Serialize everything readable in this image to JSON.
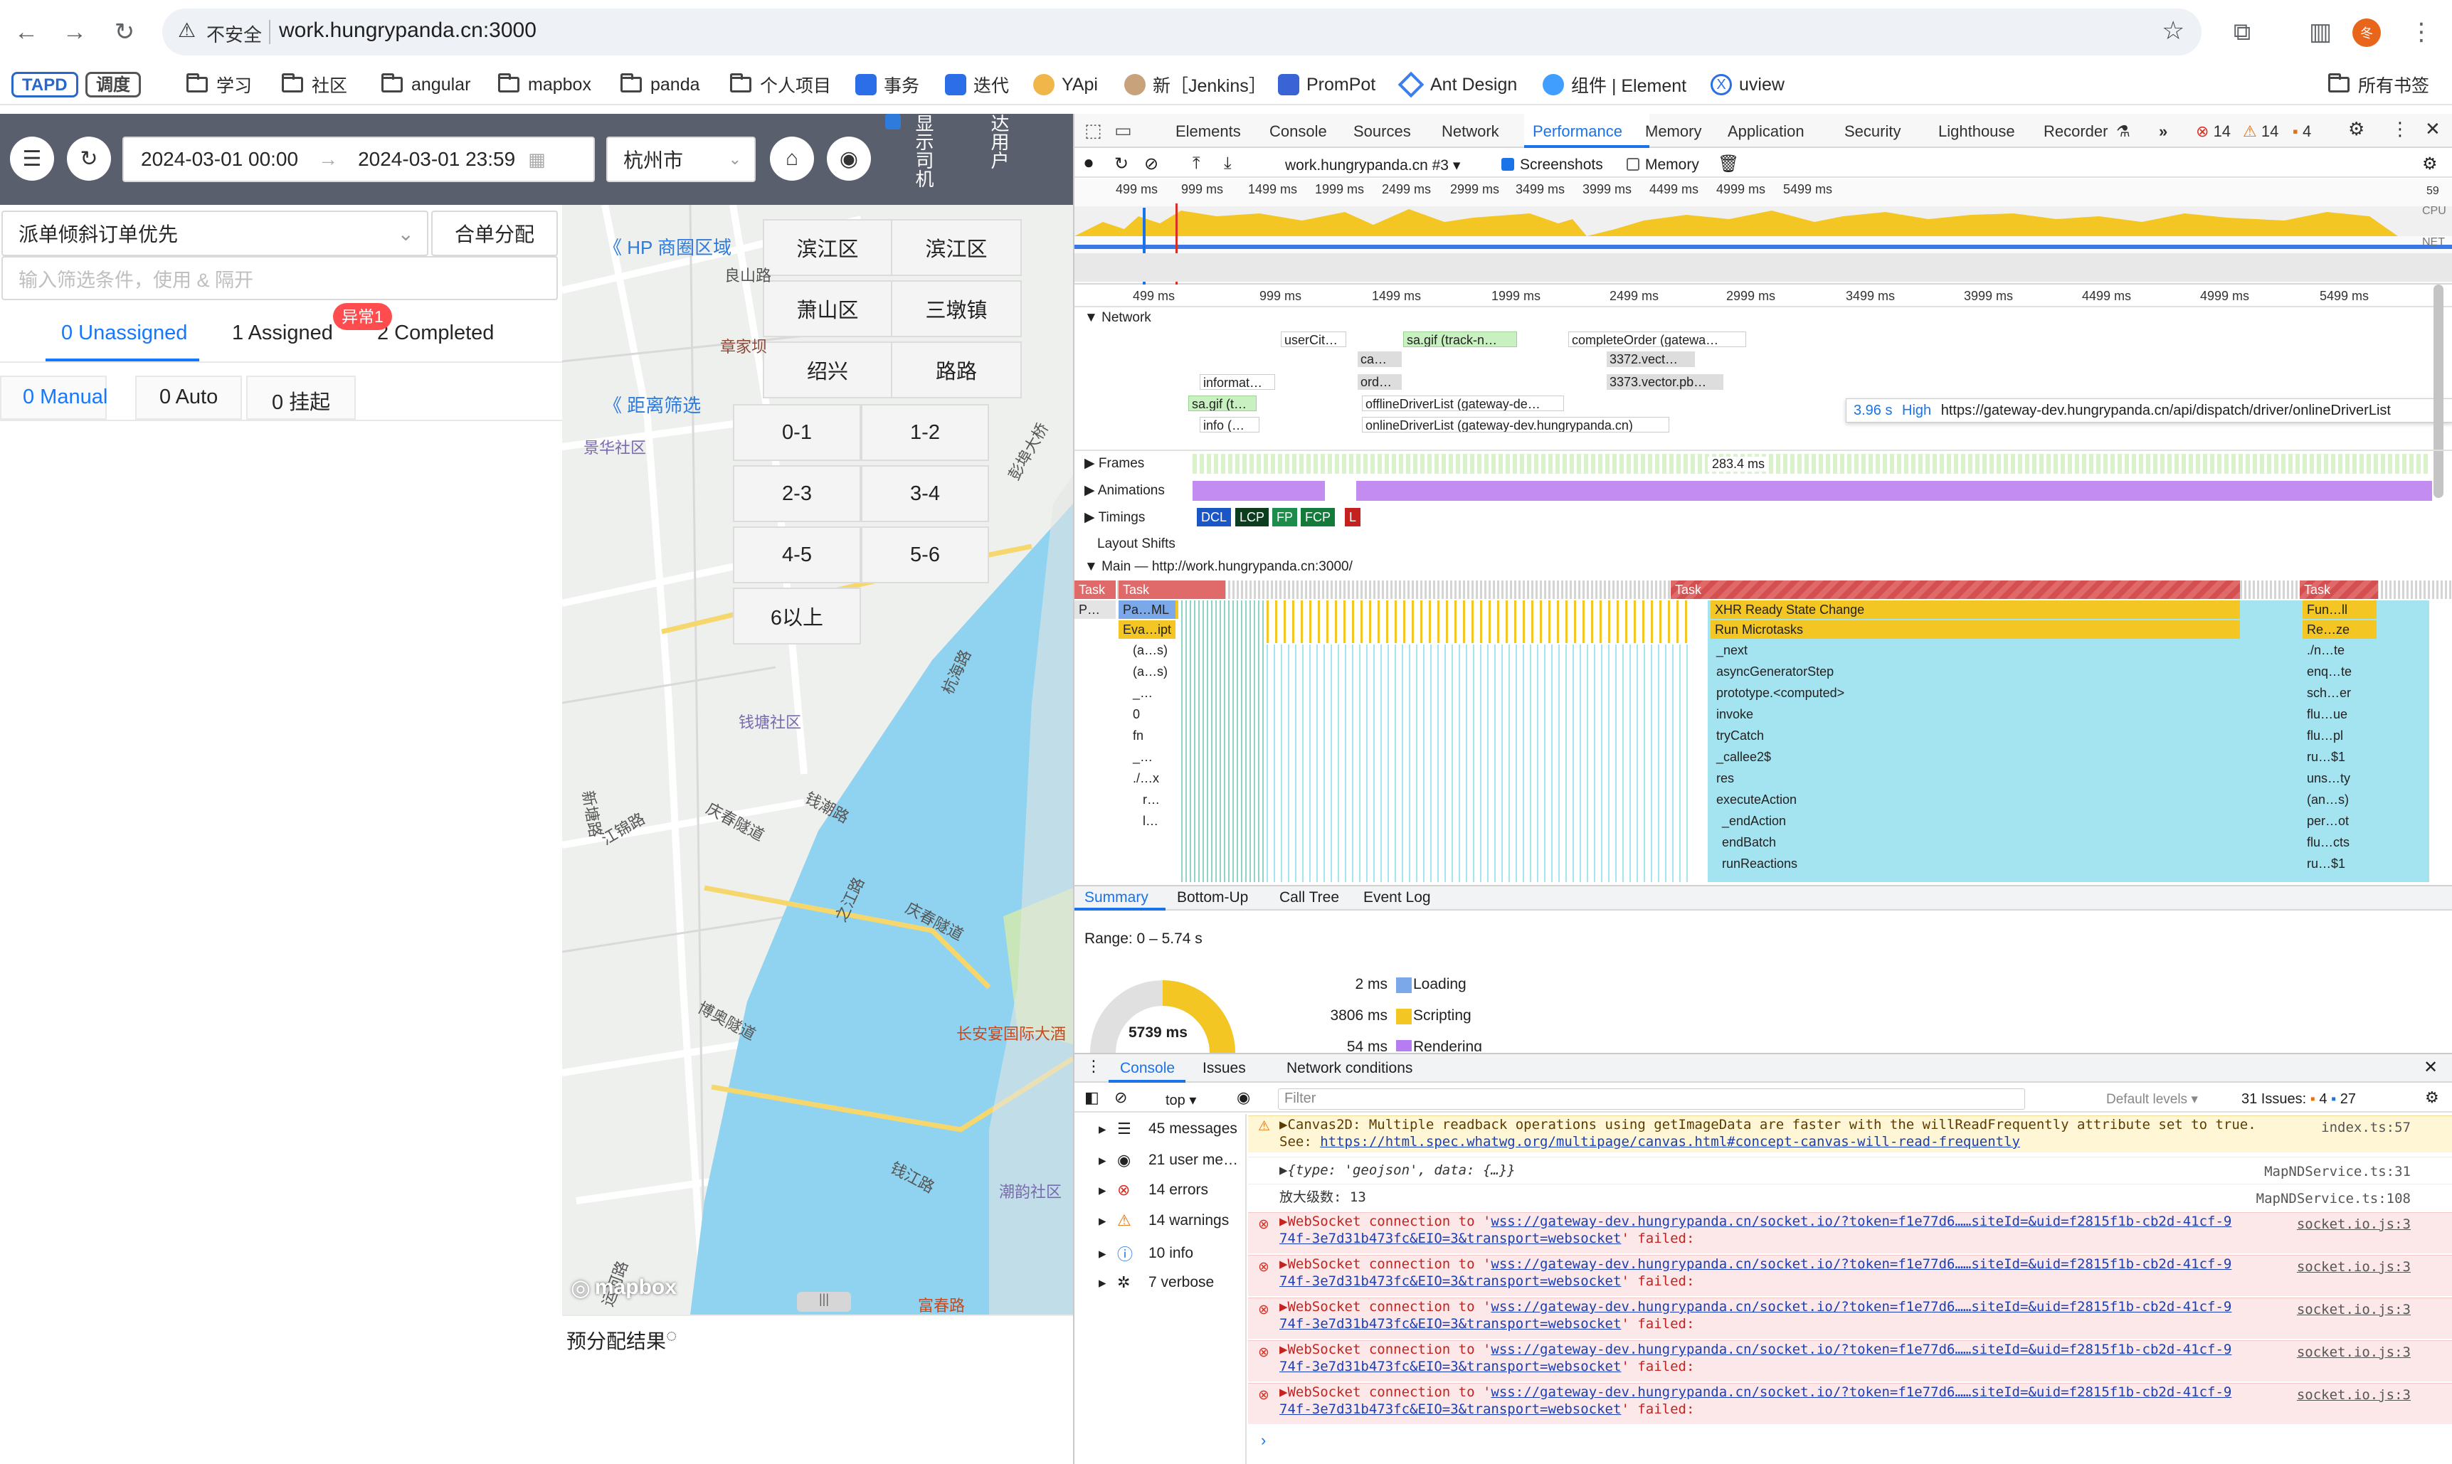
{
  "browser": {
    "security_label": "不安全",
    "url": "work.hungrypanda.cn:3000",
    "profile_initial": "冬",
    "bookmarks": [
      {
        "label": "TAPD",
        "kind": "tag"
      },
      {
        "label": "调度",
        "kind": "tag"
      },
      {
        "label": "学习",
        "kind": "folder"
      },
      {
        "label": "社区",
        "kind": "folder"
      },
      {
        "label": "angular",
        "kind": "folder"
      },
      {
        "label": "mapbox",
        "kind": "folder"
      },
      {
        "label": "panda",
        "kind": "folder"
      },
      {
        "label": "个人项目",
        "kind": "folder"
      },
      {
        "label": "事务",
        "kind": "site"
      },
      {
        "label": "迭代",
        "kind": "site"
      },
      {
        "label": "YApi",
        "kind": "site"
      },
      {
        "label": "新［Jenkins］",
        "kind": "site"
      },
      {
        "label": "PromPot",
        "kind": "site"
      },
      {
        "label": "Ant Design",
        "kind": "site"
      },
      {
        "label": "组件 | Element",
        "kind": "site"
      },
      {
        "label": "uview",
        "kind": "site"
      }
    ],
    "all_bookmarks": "所有书签"
  },
  "app": {
    "date_start": "2024-03-01 00:00",
    "date_sep": "→",
    "date_end": "2024-03-01 23:59",
    "city": "杭州市",
    "toggle_label_1": "显示司机",
    "toggle_label_2": "达用户",
    "strategy_select": "派单倾斜订单优先",
    "merge_button": "合单分配",
    "filter_placeholder": "输入筛选条件，使用 & 隔开",
    "status_tabs": [
      "0 Unassigned",
      "1 Assigned",
      "2 Completed"
    ],
    "exception_badge": "异常1",
    "sub_tabs": [
      "0 Manual",
      "0 Auto",
      "0 挂起"
    ]
  },
  "map": {
    "hp_area_link": "HP 商圈区域",
    "distance_filter_link": "距离筛选",
    "area_buttons": [
      "滨江区",
      "滨江区",
      "萧山区",
      "三墩镇",
      "绍兴",
      "路路"
    ],
    "distance_buttons": [
      "0-1",
      "1-2",
      "2-3",
      "3-4",
      "4-5",
      "5-6",
      "6以上"
    ],
    "labels": [
      "良山路",
      "章家坝",
      "景华社区",
      "钱塘社区",
      "庆春隧道",
      "钱潮路",
      "江锦路",
      "长安宴国际大酒",
      "潮韵社区",
      "博奥隧道",
      "庆春隧道",
      "之江路",
      "彭埠大桥",
      "杭海路",
      "新塘路",
      "钱江路",
      "运河路",
      "富春路"
    ],
    "attribution": "mapbox",
    "pre_assign_result": "预分配结果"
  },
  "devtools": {
    "tabs": [
      "Elements",
      "Console",
      "Sources",
      "Network",
      "Performance",
      "Memory",
      "Application",
      "Security",
      "Lighthouse",
      "Recorder"
    ],
    "active_tab": "Performance",
    "error_count": "14",
    "warning_count": "14",
    "issue_count": "4",
    "recording_select": "work.hungrypanda.cn #3",
    "screenshots_label": "Screenshots",
    "memory_label": "Memory",
    "ruler_ticks": [
      "499 ms",
      "999 ms",
      "1499 ms",
      "1999 ms",
      "2499 ms",
      "2999 ms",
      "3499 ms",
      "3999 ms",
      "4499 ms",
      "4999 ms",
      "5499 ms"
    ],
    "cpu_label": "CPU",
    "net_label": "NET",
    "overview_end": "59",
    "tracks": {
      "network": "Network",
      "frames": "Frames",
      "animations": "Animations",
      "timings": "Timings",
      "layout_shifts": "Layout Shifts",
      "main": "Main — http://work.hungrypanda.cn:3000/"
    },
    "network_requests": [
      "userCit…",
      "sa.gif (track-n…",
      "completeOrder (gatewa…",
      "ca…",
      "3372.vect…",
      "informat…",
      "ord…",
      "3373.vector.pb…",
      "sa.gif (t…",
      "offlineDriverList (gateway-de…",
      "info (…",
      "onlineDriverList (gateway-dev.hungrypanda.cn)"
    ],
    "tooltip_time": "3.96 s",
    "tooltip_priority": "High",
    "tooltip_url": "https://gateway-dev.hungrypanda.cn/api/dispatch/driver/onlineDriverList",
    "frame_duration": "283.4 ms",
    "timing_markers": [
      "DCL",
      "LCP",
      "FP",
      "FCP",
      "L"
    ],
    "flame_left": [
      "Task",
      "Task",
      "P…",
      "Pa…ML",
      "Eva…ipt",
      "(a…s)",
      "(a…s)",
      "_…",
      "0",
      "fn",
      "_…",
      "./…x",
      "r…",
      "l…"
    ],
    "flame_mid": [
      "Task",
      "XHR Ready State Change",
      "Run Microtasks",
      "_next",
      "asyncGeneratorStep",
      "prototype.<computed>",
      "invoke",
      "tryCatch",
      "_callee2$",
      "res",
      "executeAction",
      "_endAction",
      "endBatch",
      "runReactions"
    ],
    "flame_right": [
      "Task",
      "Fun…ll",
      "Re…ze",
      "./n…te",
      "enq…te",
      "sch…er",
      "flu…ue",
      "flu…pl",
      "ru…$1",
      "uns…ty",
      "(an…s)",
      "per…ot",
      "flu…cts",
      "ru…$1"
    ],
    "summary_tabs": [
      "Summary",
      "Bottom-Up",
      "Call Tree",
      "Event Log"
    ],
    "range": "Range: 0 – 5.74 s",
    "total_ms": "5739 ms",
    "summary_rows": [
      {
        "ms": "2 ms",
        "label": "Loading",
        "color": "#7aa8e8"
      },
      {
        "ms": "3806 ms",
        "label": "Scripting",
        "color": "#f3c623"
      },
      {
        "ms": "54 ms",
        "label": "Rendering",
        "color": "#b67cf2"
      }
    ],
    "drawer_tabs": [
      "Console",
      "Issues",
      "Network conditions"
    ],
    "console_context": "top",
    "filter_placeholder": "Filter",
    "default_levels": "Default levels",
    "issues_label": "31 Issues:",
    "issues_warn": "4",
    "issues_info": "27",
    "sidebar": [
      {
        "label": "45 messages",
        "icon": "list-icon"
      },
      {
        "label": "21 user me…",
        "icon": "user-icon"
      },
      {
        "label": "14 errors",
        "icon": "error-icon"
      },
      {
        "label": "14 warnings",
        "icon": "warning-icon"
      },
      {
        "label": "10 info",
        "icon": "info-icon"
      },
      {
        "label": "7 verbose",
        "icon": "bug-icon"
      }
    ],
    "console_messages": [
      {
        "type": "warn",
        "line1": "▶Canvas2D: Multiple readback operations using getImageData are faster with the willReadFrequently attribute set to true.",
        "line2_prefix": "See: ",
        "line2_link": "https://html.spec.whatwg.org/multipage/canvas.html#concept-canvas-will-read-frequently",
        "source": "index.ts:57"
      },
      {
        "type": "log",
        "line1": "▶{type: 'geojson', data: {…}}",
        "source": "MapNDService.ts:31"
      },
      {
        "type": "log",
        "line1": "放大级数: 13",
        "source": "MapNDService.ts:108"
      },
      {
        "type": "error",
        "line1_prefix": "▶WebSocket connection to '",
        "line1_link": "wss://gateway-dev.hungrypanda.cn/socket.io/?token=f1e77d6……siteId=&uid=f2815f1b-cb2d-41cf-9",
        "line2_link": "74f-3e7d31b473fc&EIO=3&transport=websocket",
        "line2_suffix": "' failed:",
        "source": "socket.io.js:3"
      },
      {
        "type": "error",
        "line1_prefix": "▶WebSocket connection to '",
        "line1_link": "wss://gateway-dev.hungrypanda.cn/socket.io/?token=f1e77d6……siteId=&uid=f2815f1b-cb2d-41cf-9",
        "line2_link": "74f-3e7d31b473fc&EIO=3&transport=websocket",
        "line2_suffix": "' failed:",
        "source": "socket.io.js:3"
      },
      {
        "type": "error",
        "line1_prefix": "▶WebSocket connection to '",
        "line1_link": "wss://gateway-dev.hungrypanda.cn/socket.io/?token=f1e77d6……siteId=&uid=f2815f1b-cb2d-41cf-9",
        "line2_link": "74f-3e7d31b473fc&EIO=3&transport=websocket",
        "line2_suffix": "' failed:",
        "source": "socket.io.js:3"
      },
      {
        "type": "error",
        "line1_prefix": "▶WebSocket connection to '",
        "line1_link": "wss://gateway-dev.hungrypanda.cn/socket.io/?token=f1e77d6……siteId=&uid=f2815f1b-cb2d-41cf-9",
        "line2_link": "74f-3e7d31b473fc&EIO=3&transport=websocket",
        "line2_suffix": "' failed:",
        "source": "socket.io.js:3"
      },
      {
        "type": "error",
        "line1_prefix": "▶WebSocket connection to '",
        "line1_link": "wss://gateway-dev.hungrypanda.cn/socket.io/?token=f1e77d6……siteId=&uid=f2815f1b-cb2d-41cf-9",
        "line2_link": "74f-3e7d31b473fc&EIO=3&transport=websocket",
        "line2_suffix": "' failed:",
        "source": "socket.io.js:3"
      }
    ]
  },
  "colors": {
    "accent": "#1a73e8",
    "app_header": "#5a5f6e",
    "scripting": "#f3c623",
    "rendering": "#b67cf2",
    "loading": "#7aa8e8",
    "water": "#8fd3f0",
    "error_bg": "#fce8e8",
    "warning_bg": "#fef6d5"
  }
}
